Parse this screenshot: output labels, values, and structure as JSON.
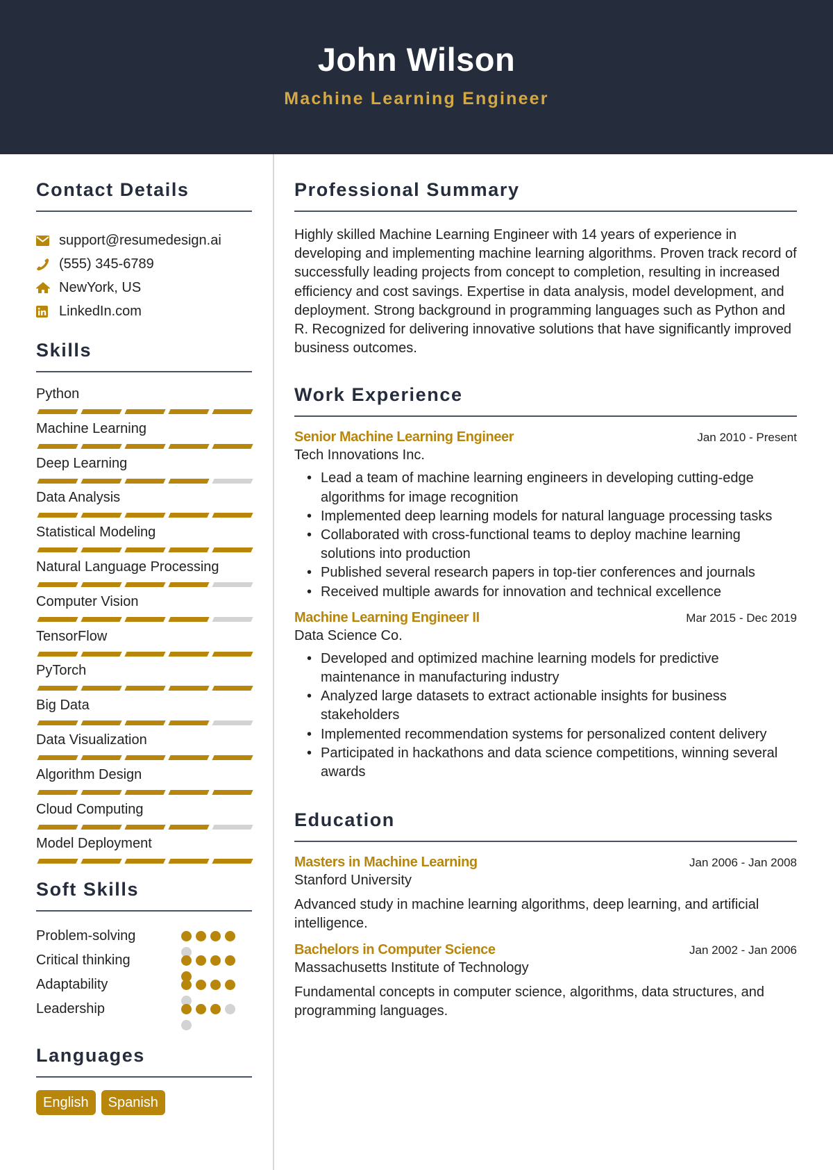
{
  "header": {
    "name": "John Wilson",
    "title": "Machine Learning Engineer"
  },
  "colors": {
    "header_bg": "#252D3D",
    "accent": "#B8860B",
    "title_gold": "#D4A843",
    "inactive": "#D3D3D3"
  },
  "contact": {
    "title": "Contact Details",
    "items": [
      {
        "icon": "envelope-icon",
        "text": "support@resumedesign.ai"
      },
      {
        "icon": "phone-icon",
        "text": "(555) 345-6789"
      },
      {
        "icon": "home-icon",
        "text": "NewYork, US"
      },
      {
        "icon": "linkedin-icon",
        "text": "LinkedIn.com"
      }
    ]
  },
  "skills": {
    "title": "Skills",
    "max": 5,
    "items": [
      {
        "name": "Python",
        "level": 5
      },
      {
        "name": "Machine Learning",
        "level": 5
      },
      {
        "name": "Deep Learning",
        "level": 4
      },
      {
        "name": "Data Analysis",
        "level": 5
      },
      {
        "name": "Statistical Modeling",
        "level": 5
      },
      {
        "name": "Natural Language Processing",
        "level": 4
      },
      {
        "name": "Computer Vision",
        "level": 4
      },
      {
        "name": "TensorFlow",
        "level": 5
      },
      {
        "name": "PyTorch",
        "level": 5
      },
      {
        "name": "Big Data",
        "level": 4
      },
      {
        "name": "Data Visualization",
        "level": 5
      },
      {
        "name": "Algorithm Design",
        "level": 5
      },
      {
        "name": "Cloud Computing",
        "level": 4
      },
      {
        "name": "Model Deployment",
        "level": 5
      }
    ]
  },
  "soft_skills": {
    "title": "Soft Skills",
    "max": 5,
    "items": [
      {
        "name": "Problem-solving",
        "level": 4
      },
      {
        "name": "Critical thinking",
        "level": 5
      },
      {
        "name": "Adaptability",
        "level": 4
      },
      {
        "name": "Leadership",
        "level": 3
      }
    ]
  },
  "languages": {
    "title": "Languages",
    "items": [
      "English",
      "Spanish"
    ]
  },
  "summary": {
    "title": "Professional Summary",
    "text": "Highly skilled Machine Learning Engineer with 14 years of experience in developing and implementing machine learning algorithms. Proven track record of successfully leading projects from concept to completion, resulting in increased efficiency and cost savings. Expertise in data analysis, model development, and deployment. Strong background in programming languages such as Python and R. Recognized for delivering innovative solutions that have significantly improved business outcomes."
  },
  "experience": {
    "title": "Work Experience",
    "jobs": [
      {
        "title": "Senior Machine Learning Engineer",
        "company": "Tech Innovations Inc.",
        "dates": "Jan 2010 - Present",
        "bullets": [
          "Lead a team of machine learning engineers in developing cutting-edge algorithms for image recognition",
          "Implemented deep learning models for natural language processing tasks",
          "Collaborated with cross-functional teams to deploy machine learning solutions into production",
          "Published several research papers in top-tier conferences and journals",
          "Received multiple awards for innovation and technical excellence"
        ]
      },
      {
        "title": "Machine Learning Engineer II",
        "company": "Data Science Co.",
        "dates": "Mar 2015 - Dec 2019",
        "bullets": [
          "Developed and optimized machine learning models for predictive maintenance in manufacturing industry",
          "Analyzed large datasets to extract actionable insights for business stakeholders",
          "Implemented recommendation systems for personalized content delivery",
          "Participated in hackathons and data science competitions, winning several awards"
        ]
      }
    ]
  },
  "education": {
    "title": "Education",
    "items": [
      {
        "degree": "Masters in Machine Learning",
        "school": "Stanford University",
        "dates": "Jan 2006 - Jan 2008",
        "description": "Advanced study in machine learning algorithms, deep learning, and artificial intelligence."
      },
      {
        "degree": "Bachelors in Computer Science",
        "school": "Massachusetts Institute of Technology",
        "dates": "Jan 2002 - Jan 2006",
        "description": "Fundamental concepts in computer science, algorithms, data structures, and programming languages."
      }
    ]
  }
}
